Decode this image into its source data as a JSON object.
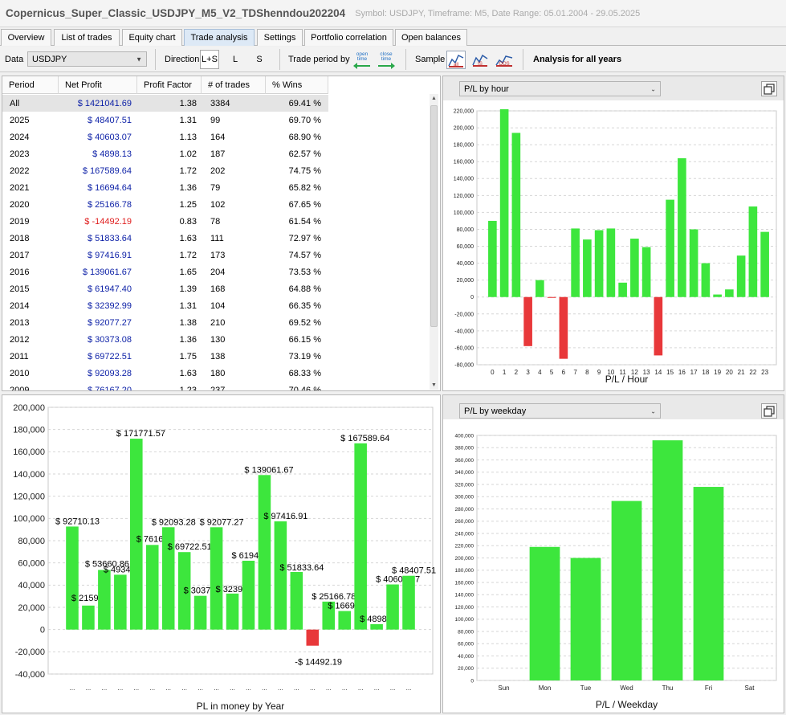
{
  "window": {
    "title": "Copernicus_Super_Classic_USDJPY_M5_V2_TDShenndou202204",
    "subtitle": "Symbol: USDJPY, Timeframe: M5, Date Range: 05.01.2004 - 29.05.2025"
  },
  "tabs": [
    {
      "label": "Overview",
      "active": false
    },
    {
      "label": "List of trades",
      "active": false
    },
    {
      "label": "Equity chart",
      "active": false
    },
    {
      "label": "Trade analysis",
      "active": true
    },
    {
      "label": "Settings",
      "active": false
    },
    {
      "label": "Portfolio correlation",
      "active": false
    },
    {
      "label": "Open balances",
      "active": false
    }
  ],
  "toolbar": {
    "data_label": "Data",
    "data_value": "USDJPY",
    "direction_label": "Direction",
    "direction_options": [
      "L+S",
      "L",
      "S"
    ],
    "direction_selected": "L+S",
    "trade_period_label": "Trade period by",
    "open_time_label": "open time",
    "close_time_label": "close time",
    "sample_label": "Sample",
    "sample_icons": [
      "all-samples-chart-icon",
      "in-sample-chart-icon",
      "out-of-sample-chart-icon"
    ],
    "analysis_label": "Analysis for all years"
  },
  "table": {
    "columns": [
      "Period",
      "Net Profit",
      "Profit Factor",
      "# of trades",
      "% Wins"
    ],
    "rows": [
      {
        "period": "All",
        "net_profit": "$ 1421041.69",
        "profit_factor": "1.38",
        "trades": "3384",
        "wins": "69.41 %",
        "negative": false,
        "selected": true
      },
      {
        "period": "2025",
        "net_profit": "$ 48407.51",
        "profit_factor": "1.31",
        "trades": "99",
        "wins": "69.70 %",
        "negative": false,
        "selected": false
      },
      {
        "period": "2024",
        "net_profit": "$ 40603.07",
        "profit_factor": "1.13",
        "trades": "164",
        "wins": "68.90 %",
        "negative": false,
        "selected": false
      },
      {
        "period": "2023",
        "net_profit": "$ 4898.13",
        "profit_factor": "1.02",
        "trades": "187",
        "wins": "62.57 %",
        "negative": false,
        "selected": false
      },
      {
        "period": "2022",
        "net_profit": "$ 167589.64",
        "profit_factor": "1.72",
        "trades": "202",
        "wins": "74.75 %",
        "negative": false,
        "selected": false
      },
      {
        "period": "2021",
        "net_profit": "$ 16694.64",
        "profit_factor": "1.36",
        "trades": "79",
        "wins": "65.82 %",
        "negative": false,
        "selected": false
      },
      {
        "period": "2020",
        "net_profit": "$ 25166.78",
        "profit_factor": "1.25",
        "trades": "102",
        "wins": "67.65 %",
        "negative": false,
        "selected": false
      },
      {
        "period": "2019",
        "net_profit": "$ -14492.19",
        "profit_factor": "0.83",
        "trades": "78",
        "wins": "61.54 %",
        "negative": true,
        "selected": false
      },
      {
        "period": "2018",
        "net_profit": "$ 51833.64",
        "profit_factor": "1.63",
        "trades": "111",
        "wins": "72.97 %",
        "negative": false,
        "selected": false
      },
      {
        "period": "2017",
        "net_profit": "$ 97416.91",
        "profit_factor": "1.72",
        "trades": "173",
        "wins": "74.57 %",
        "negative": false,
        "selected": false
      },
      {
        "period": "2016",
        "net_profit": "$ 139061.67",
        "profit_factor": "1.65",
        "trades": "204",
        "wins": "73.53 %",
        "negative": false,
        "selected": false
      },
      {
        "period": "2015",
        "net_profit": "$ 61947.40",
        "profit_factor": "1.39",
        "trades": "168",
        "wins": "64.88 %",
        "negative": false,
        "selected": false
      },
      {
        "period": "2014",
        "net_profit": "$ 32392.99",
        "profit_factor": "1.31",
        "trades": "104",
        "wins": "66.35 %",
        "negative": false,
        "selected": false
      },
      {
        "period": "2013",
        "net_profit": "$ 92077.27",
        "profit_factor": "1.38",
        "trades": "210",
        "wins": "69.52 %",
        "negative": false,
        "selected": false
      },
      {
        "period": "2012",
        "net_profit": "$ 30373.08",
        "profit_factor": "1.36",
        "trades": "130",
        "wins": "66.15 %",
        "negative": false,
        "selected": false
      },
      {
        "period": "2011",
        "net_profit": "$ 69722.51",
        "profit_factor": "1.75",
        "trades": "138",
        "wins": "73.19 %",
        "negative": false,
        "selected": false
      },
      {
        "period": "2010",
        "net_profit": "$ 92093.28",
        "profit_factor": "1.63",
        "trades": "180",
        "wins": "68.33 %",
        "negative": false,
        "selected": false
      },
      {
        "period": "2009",
        "net_profit": "$ 76167.20",
        "profit_factor": "1.23",
        "trades": "237",
        "wins": "70.46 %",
        "negative": false,
        "selected": false
      }
    ]
  },
  "hour_panel": {
    "dropdown": "P/L by hour"
  },
  "weekday_panel": {
    "dropdown": "P/L by weekday"
  },
  "colors": {
    "positive": "#3de63d",
    "negative": "#e8383a",
    "profit_text": "#0b1fa6",
    "loss_text": "#e02020"
  },
  "chart_data": [
    {
      "id": "hour",
      "type": "bar",
      "xlabel": "P/L / Hour",
      "categories": [
        "0",
        "1",
        "2",
        "3",
        "4",
        "5",
        "6",
        "7",
        "8",
        "9",
        "10",
        "11",
        "12",
        "13",
        "14",
        "15",
        "16",
        "17",
        "18",
        "19",
        "20",
        "21",
        "22",
        "23"
      ],
      "values": [
        90000,
        222000,
        194000,
        -58000,
        20000,
        -1000,
        -73000,
        81000,
        68000,
        79000,
        81000,
        17000,
        69000,
        59000,
        -69000,
        115000,
        164000,
        80000,
        40000,
        3000,
        9000,
        49000,
        107000,
        77000
      ],
      "ylim": [
        -80000,
        220000
      ],
      "yticks": [
        -80000,
        -60000,
        -40000,
        -20000,
        0,
        20000,
        40000,
        60000,
        80000,
        100000,
        120000,
        140000,
        160000,
        180000,
        200000,
        220000
      ],
      "ytick_labels": [
        "-80,000",
        "-60,000",
        "-40,000",
        "-20,000",
        "0",
        "20,000",
        "40,000",
        "60,000",
        "80,000",
        "100,000",
        "120,000",
        "140,000",
        "160,000",
        "180,000",
        "200,000",
        "220,000"
      ],
      "grid": true
    },
    {
      "id": "year",
      "type": "bar",
      "xlabel": "PL in money by Year",
      "categories": [
        "...",
        "...",
        "...",
        "...",
        "...",
        "...",
        "...",
        "...",
        "...",
        "...",
        "...",
        "...",
        "...",
        "...",
        "...",
        "...",
        "...",
        "...",
        "...",
        "...",
        "...",
        "..."
      ],
      "values": [
        92710.13,
        21597,
        53660.86,
        49348,
        171771.57,
        76167,
        92093.28,
        69722.51,
        30373,
        92077.27,
        32392,
        61947,
        139061.67,
        97416.91,
        51833.64,
        -14492.19,
        25166.78,
        16694,
        167589.64,
        4898,
        40603.07,
        48407.51
      ],
      "labels": [
        "$ 92710.13",
        "$ 21597",
        "$ 53660.86",
        "$ 49348",
        "$ 171771.57",
        "$ 76167",
        "$ 92093.28",
        "$ 69722.51",
        "$ 30373",
        "$ 92077.27",
        "$ 32392",
        "$ 61947",
        "$ 139061.67",
        "$ 97416.91",
        "$ 51833.64",
        "-$ 14492.19",
        "$ 25166.78",
        "$ 16694",
        "$ 167589.64",
        "$ 4898.",
        "$ 40603.07",
        "$ 48407.51"
      ],
      "ylim": [
        -40000,
        200000
      ],
      "yticks": [
        -40000,
        -20000,
        0,
        20000,
        40000,
        60000,
        80000,
        100000,
        120000,
        140000,
        160000,
        180000,
        200000
      ],
      "ytick_labels": [
        "-40,000",
        "-20,000",
        "0",
        "20,000",
        "40,000",
        "60,000",
        "80,000",
        "100,000",
        "120,000",
        "140,000",
        "160,000",
        "180,000",
        "200,000"
      ],
      "grid": true
    },
    {
      "id": "weekday",
      "type": "bar",
      "xlabel": "P/L / Weekday",
      "categories": [
        "Sun",
        "Mon",
        "Tue",
        "Wed",
        "Thu",
        "Fri",
        "Sat"
      ],
      "values": [
        0,
        218000,
        200000,
        293000,
        392000,
        316000,
        0
      ],
      "ylim": [
        0,
        400000
      ],
      "yticks": [
        0,
        20000,
        40000,
        60000,
        80000,
        100000,
        120000,
        140000,
        160000,
        180000,
        200000,
        220000,
        240000,
        260000,
        280000,
        300000,
        320000,
        340000,
        360000,
        380000,
        400000
      ],
      "ytick_labels": [
        "0",
        "20,000",
        "40,000",
        "60,000",
        "80,000",
        "100,000",
        "120,000",
        "140,000",
        "160,000",
        "180,000",
        "200,000",
        "220,000",
        "240,000",
        "260,000",
        "280,000",
        "300,000",
        "320,000",
        "340,000",
        "360,000",
        "380,000",
        "400,000"
      ],
      "grid": true
    }
  ]
}
